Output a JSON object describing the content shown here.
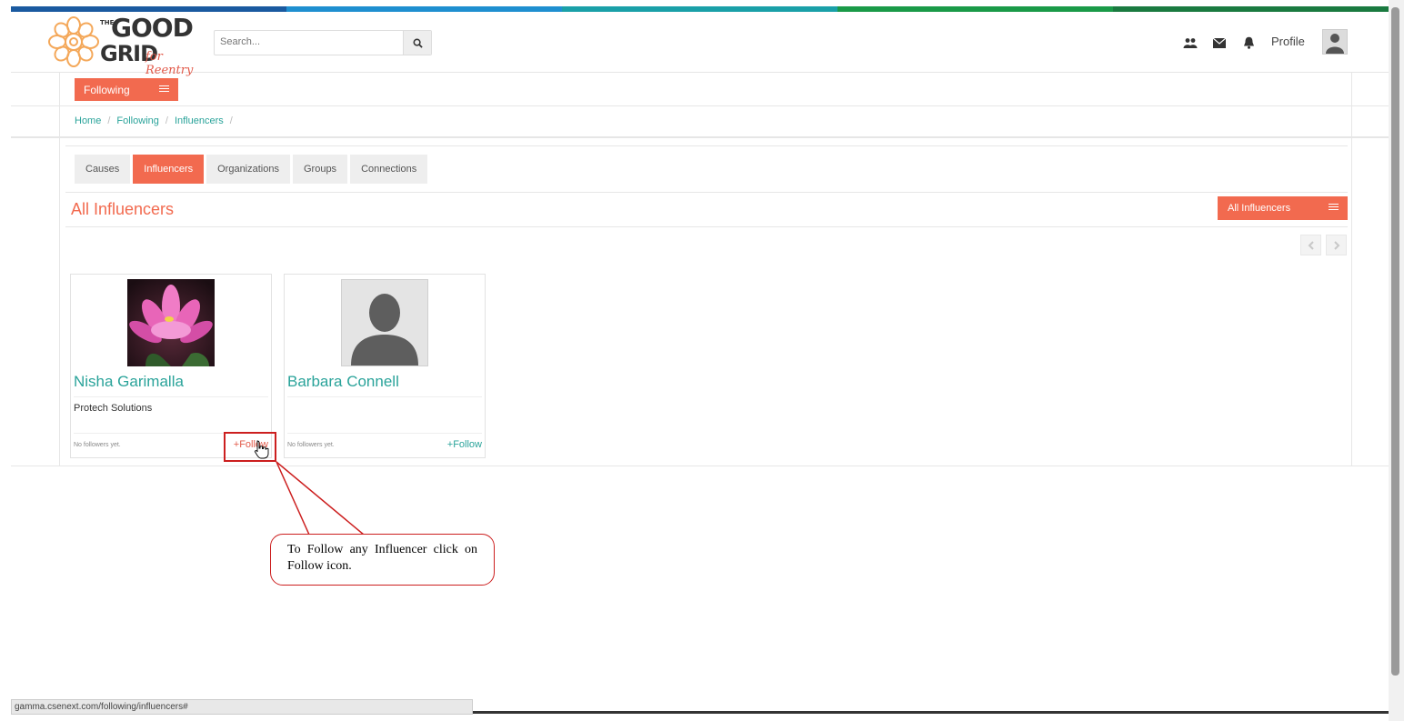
{
  "app": {
    "logo_alt": "The Good Grid for Reentry",
    "logo_line1": "GOOD",
    "logo_line2": "GRID",
    "logo_the": "THE",
    "logo_tagline": "for Reentry"
  },
  "header": {
    "search_placeholder": "Search...",
    "profile_label": "Profile",
    "icons": [
      "users-icon",
      "envelope-icon",
      "bell-icon",
      "search-icon",
      "avatar-icon"
    ]
  },
  "colors": {
    "accent": "#f26a4f",
    "link": "#2aa39a",
    "stripe": [
      "#1a5aa0",
      "#1f8fd0",
      "#1aa0a8",
      "#1a9a48",
      "#1a7a40"
    ]
  },
  "following_menu": {
    "label": "Following"
  },
  "breadcrumb": {
    "items": [
      "Home",
      "Following",
      "Influencers"
    ]
  },
  "tabs": [
    {
      "label": "Causes",
      "active": false
    },
    {
      "label": "Influencers",
      "active": true
    },
    {
      "label": "Organizations",
      "active": false
    },
    {
      "label": "Groups",
      "active": false
    },
    {
      "label": "Connections",
      "active": false
    }
  ],
  "section": {
    "title": "All Influencers",
    "filter_label": "All Influencers"
  },
  "influencers": [
    {
      "name": "Nisha Garimalla",
      "organization": "Protech Solutions",
      "followers_text": "No followers yet.",
      "follow_label": "+Follow"
    },
    {
      "name": "Barbara Connell",
      "organization": "",
      "followers_text": "No followers yet.",
      "follow_label": "+Follow"
    }
  ],
  "callout": {
    "text": "To Follow any Influencer click on Follow icon."
  },
  "status_bar": {
    "url": "gamma.csenext.com/following/influencers#"
  }
}
